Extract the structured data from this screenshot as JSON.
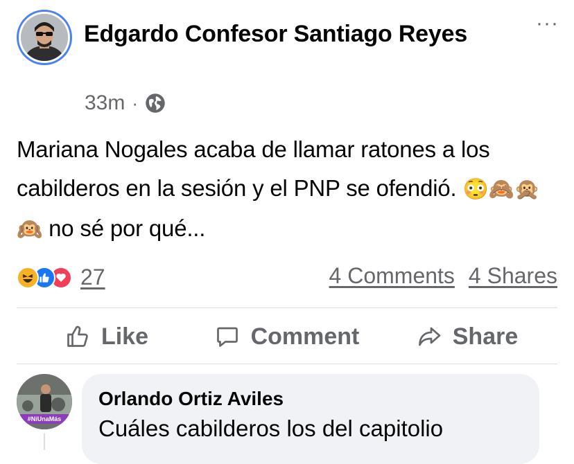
{
  "post": {
    "author": "Edgardo Confesor Santiago Reyes",
    "time": "33m",
    "separator": "·",
    "audience_icon": "globe-icon",
    "text_before": "Mariana Nogales acaba de llamar ratones a los cabilderos en la sesión y el PNP se ofendió.",
    "emojis": "😳🙈🙊🙉",
    "text_after": "no sé por qué...",
    "more_label": "···"
  },
  "reactions": {
    "types": [
      "haha-reaction-icon",
      "like-reaction-icon",
      "love-reaction-icon"
    ],
    "count": "27",
    "comments": "4 Comments",
    "shares": "4 Shares"
  },
  "actions": {
    "like": "Like",
    "comment": "Comment",
    "share": "Share"
  },
  "comment": {
    "author": "Orlando Ortiz Aviles",
    "text": "Cuáles cabilderos los del capitolio",
    "avatar_badge": "#NiUnaMás"
  },
  "colors": {
    "accent": "#1877f2",
    "avatar_ring": "#4b82f3",
    "secondary_text": "#65676b",
    "bubble_bg": "#f0f2f5"
  }
}
